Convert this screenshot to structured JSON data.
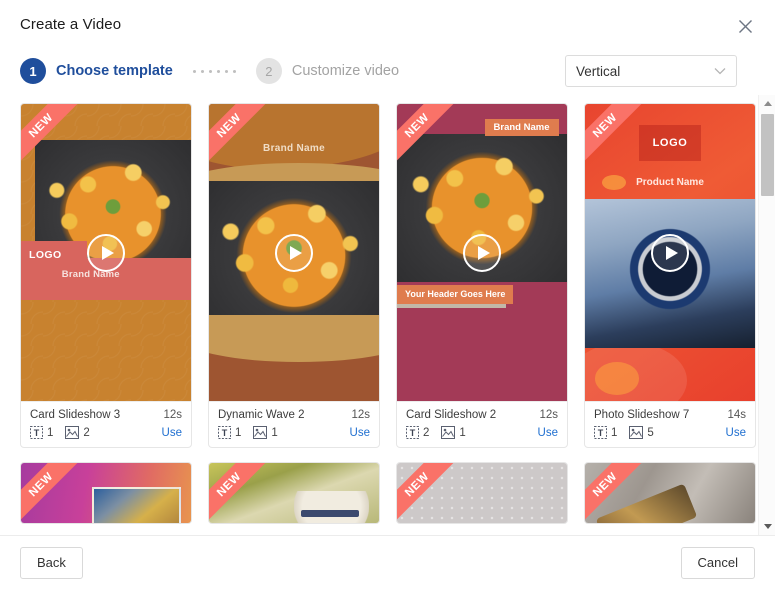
{
  "dialog": {
    "title": "Create a Video",
    "close_icon": "close-icon"
  },
  "steps": {
    "step1": {
      "number": "1",
      "label": "Choose template"
    },
    "step2": {
      "number": "2",
      "label": "Customize video"
    },
    "dots_count": 6
  },
  "orientation": {
    "selected": "Vertical",
    "chevron_icon": "chevron-down-icon"
  },
  "icons": {
    "text_layers": "text-layers-icon",
    "image_layers": "image-layers-icon",
    "play": "play-icon"
  },
  "templates": [
    {
      "name": "Card Slideshow 3",
      "duration": "12s",
      "text_count": "1",
      "image_count": "2",
      "use_label": "Use",
      "badge": "NEW",
      "art": {
        "logo": "LOGO",
        "brand": "Brand Name"
      }
    },
    {
      "name": "Dynamic Wave 2",
      "duration": "12s",
      "text_count": "1",
      "image_count": "1",
      "use_label": "Use",
      "badge": "NEW",
      "art": {
        "brand": "Brand Name"
      }
    },
    {
      "name": "Card Slideshow 2",
      "duration": "12s",
      "text_count": "2",
      "image_count": "1",
      "use_label": "Use",
      "badge": "NEW",
      "art": {
        "brand": "Brand Name",
        "header": "Your Header Goes Here"
      }
    },
    {
      "name": "Photo Slideshow 7",
      "duration": "14s",
      "text_count": "1",
      "image_count": "5",
      "use_label": "Use",
      "badge": "NEW",
      "art": {
        "logo": "LOGO",
        "product": "Product Name"
      }
    }
  ],
  "partial_templates": [
    {
      "badge": "NEW"
    },
    {
      "badge": "NEW"
    },
    {
      "badge": "NEW"
    },
    {
      "badge": "NEW"
    }
  ],
  "footer": {
    "back_label": "Back",
    "cancel_label": "Cancel"
  },
  "colors": {
    "accent_blue": "#1f4e9c",
    "link_blue": "#1f6fd0",
    "badge_red": "#fa7268"
  }
}
